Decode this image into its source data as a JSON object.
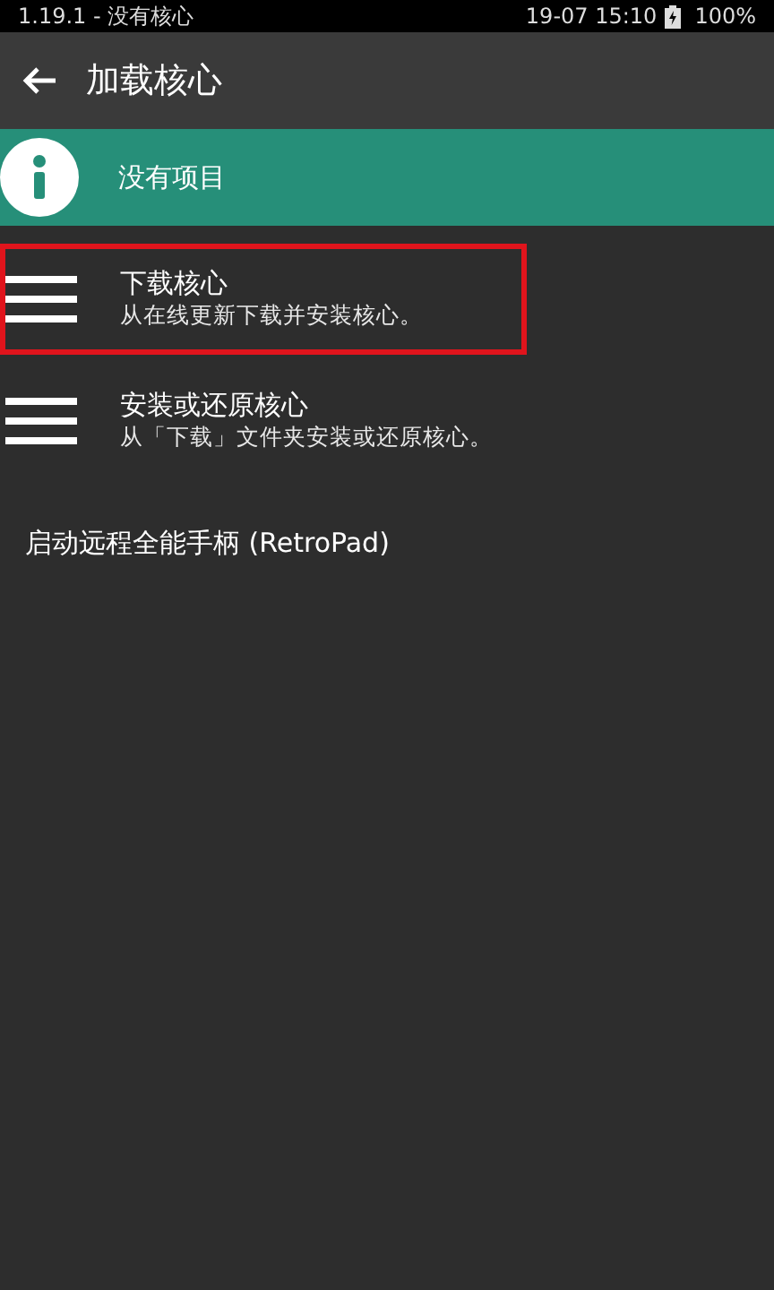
{
  "status_bar": {
    "title": "1.19.1 - 没有核心",
    "time": "19-07 15:10",
    "battery": "100%"
  },
  "header": {
    "title": "加载核心"
  },
  "notice": {
    "text": "没有项目"
  },
  "items": [
    {
      "kind": "menu",
      "label": "下载核心",
      "description": "从在线更新下载并安装核心。",
      "highlighted": true
    },
    {
      "kind": "menu",
      "label": "安装或还原核心",
      "description": "从「下载」文件夹安装或还原核心。",
      "highlighted": false
    },
    {
      "kind": "plain",
      "label": "启动远程全能手柄 (RetroPad)"
    }
  ]
}
